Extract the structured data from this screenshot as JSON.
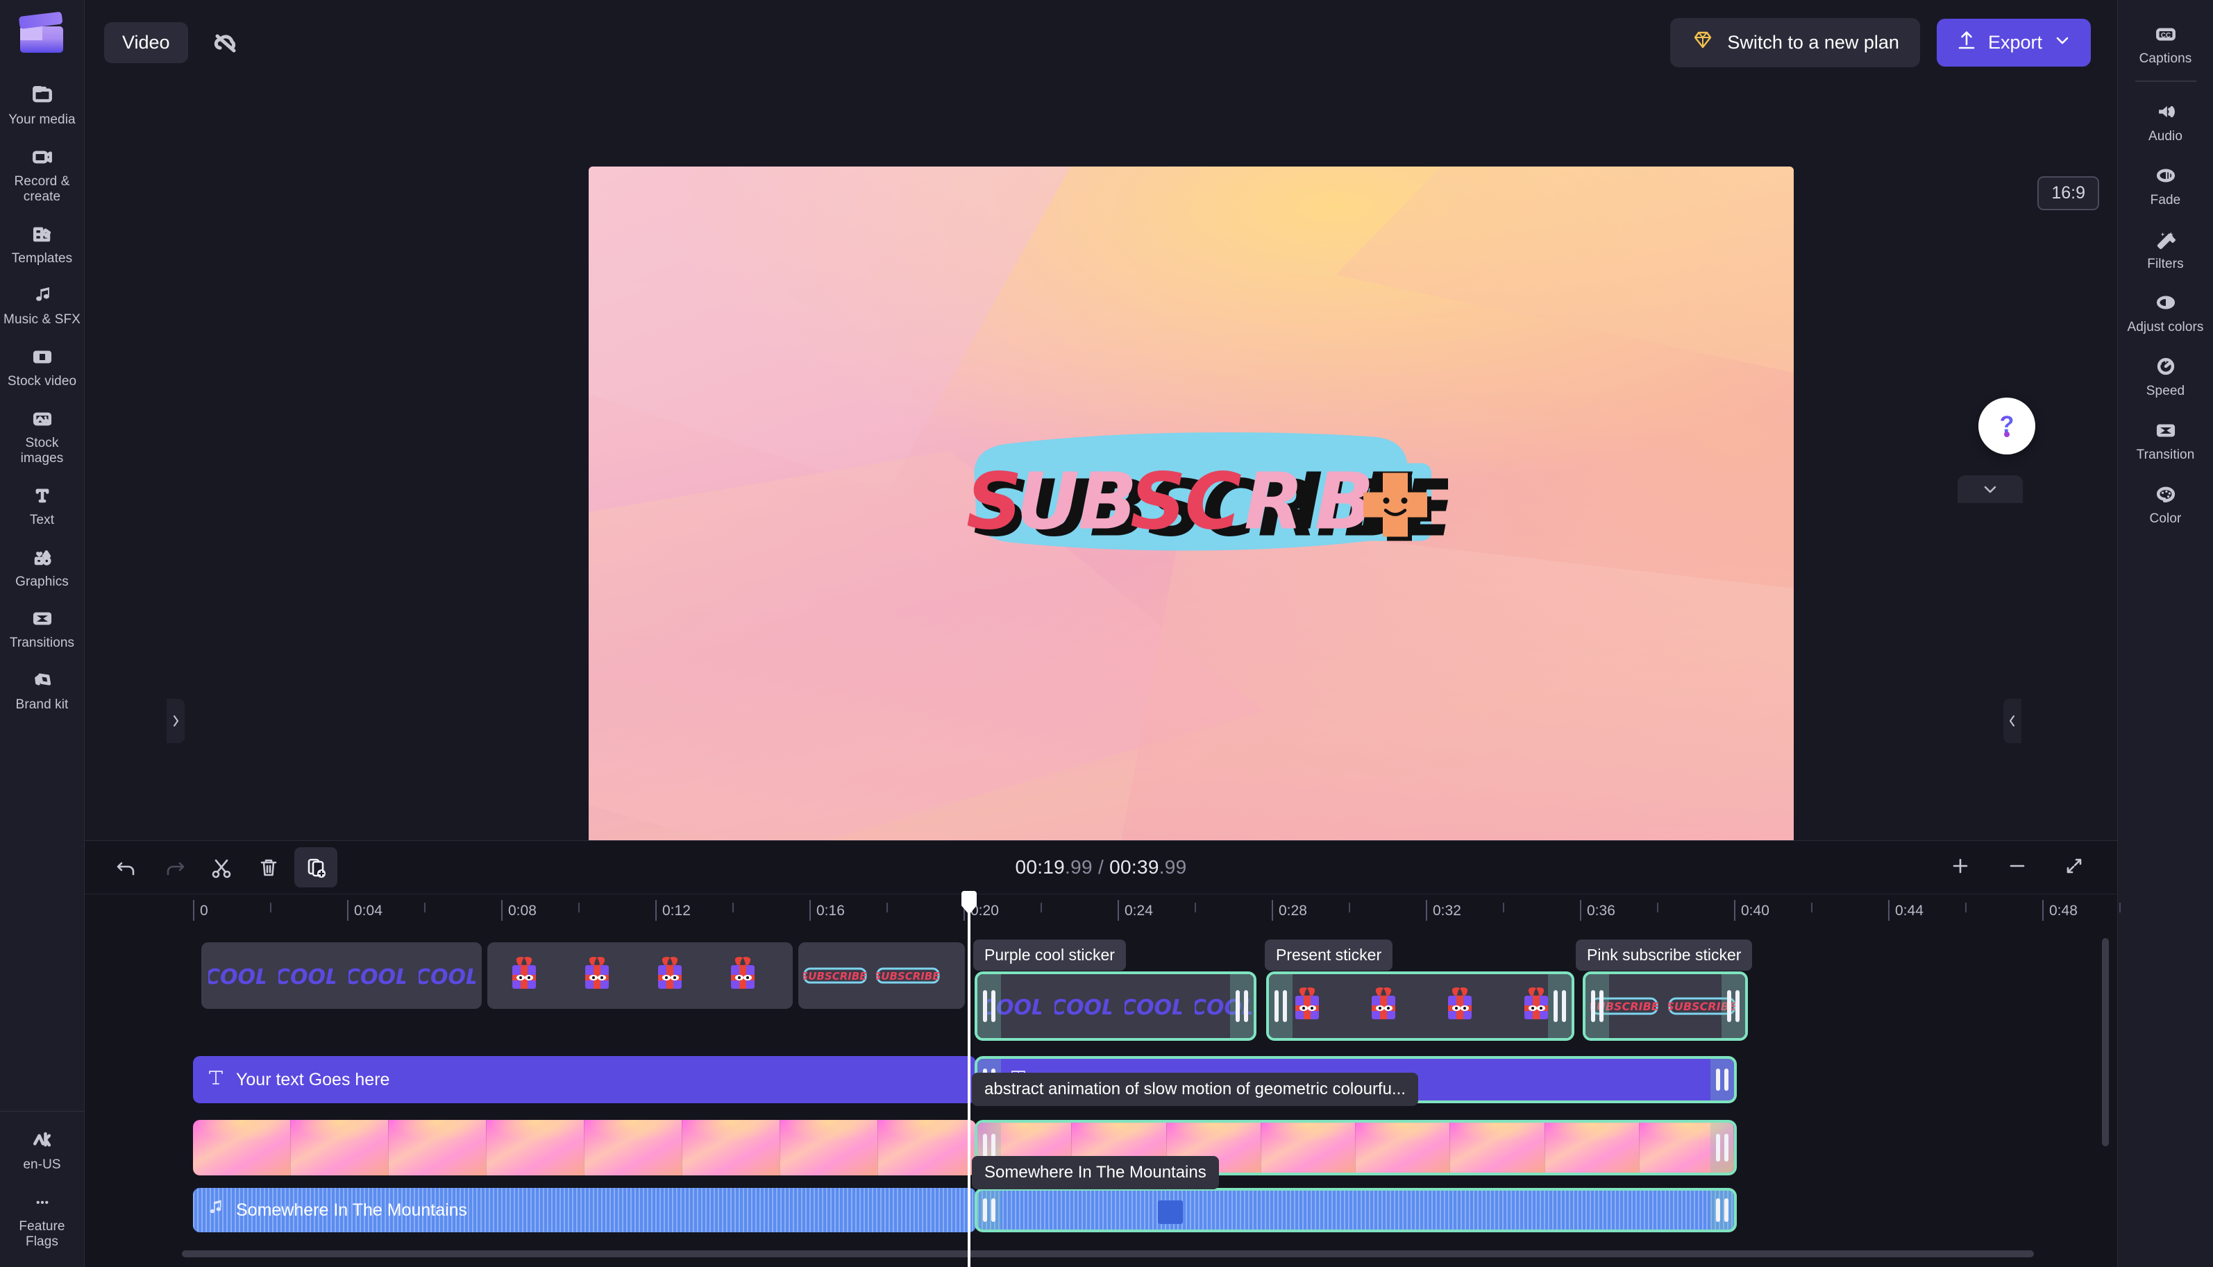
{
  "app": {
    "logo": "clapperboard-logo"
  },
  "header": {
    "video_tab": "Video",
    "cloud_icon": "cloud-off-icon",
    "plan_button": "Switch to a new plan",
    "plan_icon": "diamond-icon",
    "export_button": "Export",
    "export_icon": "upload-icon",
    "export_caret": "chevron-down-icon"
  },
  "left_sidebar": {
    "items": [
      {
        "label": "Your media",
        "icon": "folder-icon"
      },
      {
        "label": "Record & create",
        "icon": "video-camera-icon"
      },
      {
        "label": "Templates",
        "icon": "templates-icon"
      },
      {
        "label": "Music & SFX",
        "icon": "music-note-icon"
      },
      {
        "label": "Stock video",
        "icon": "film-strip-icon"
      },
      {
        "label": "Stock images",
        "icon": "image-icon"
      },
      {
        "label": "Text",
        "icon": "text-t-icon"
      },
      {
        "label": "Graphics",
        "icon": "shapes-icon"
      },
      {
        "label": "Transitions",
        "icon": "transition-icon"
      },
      {
        "label": "Brand kit",
        "icon": "tags-icon"
      }
    ],
    "bottom_items": [
      {
        "label": "en-US",
        "icon": "language-icon"
      },
      {
        "label": "Feature Flags",
        "icon": "ellipsis-icon"
      }
    ]
  },
  "right_sidebar": {
    "items": [
      {
        "label": "Captions",
        "icon": "cc-icon"
      },
      {
        "label": "Audio",
        "icon": "speaker-icon"
      },
      {
        "label": "Fade",
        "icon": "fade-icon"
      },
      {
        "label": "Filters",
        "icon": "magic-wand-icon"
      },
      {
        "label": "Adjust colors",
        "icon": "contrast-icon"
      },
      {
        "label": "Speed",
        "icon": "speedometer-icon"
      },
      {
        "label": "Transition",
        "icon": "transition-icon"
      },
      {
        "label": "Color",
        "icon": "palette-icon"
      }
    ]
  },
  "preview": {
    "aspect_ratio": "16:9",
    "sticker_text": "SUBSCRIBE",
    "sticker_colors": {
      "outline": "#7fd4ee",
      "red": "#e8425c",
      "pink": "#f4a8c4",
      "plus": "#f59a63"
    },
    "transport": {
      "skip_start": "skip-to-start-icon",
      "back5": "rewind-5-icon",
      "play": "play-icon",
      "forward5": "forward-5-icon",
      "skip_end": "skip-to-end-icon",
      "fullscreen": "fullscreen-icon"
    },
    "help_icon": "help-question-icon",
    "collapse_icon": "chevron-down-icon"
  },
  "timeline": {
    "toolbar": {
      "undo": "undo-icon",
      "redo": "redo-icon",
      "split": "scissors-icon",
      "delete": "trash-icon",
      "duplicate": "duplicate-icon",
      "zoom_in": "plus-icon",
      "zoom_out": "minus-icon",
      "fit": "fit-to-screen-icon"
    },
    "current_time": "00:19",
    "current_time_frac": ".99",
    "separator": " / ",
    "total_time": "00:39",
    "total_time_frac": ".99",
    "ruler_labels": [
      "0",
      "0:04",
      "0:08",
      "0:12",
      "0:16",
      "0:20",
      "0:24",
      "0:28",
      "0:32",
      "0:36",
      "0:40",
      "0:44",
      "0:48"
    ],
    "clip_labels": {
      "purple_cool": "Purple cool sticker",
      "present": "Present sticker",
      "pink_subscribe": "Pink subscribe sticker"
    },
    "tooltips": {
      "video": "abstract animation of slow motion of geometric colourfu...",
      "audio": "Somewhere In The Mountains"
    },
    "text_clip_label": "Your text Goes here",
    "audio_clip_label": "Somewhere In The Mountains",
    "selected_border_color": "#7fe3c0",
    "text_clip_color": "#5b4ae0",
    "audio_clip_color": "#5b8cf0"
  }
}
